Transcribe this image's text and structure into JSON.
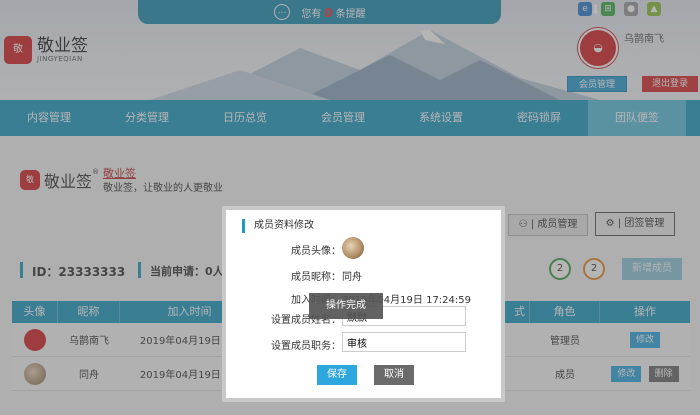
{
  "notice": {
    "prefix": "您有",
    "count": "0",
    "suffix": "条提醒"
  },
  "brand": {
    "name": "敬业签",
    "pinyin": "JINGYEQIAN",
    "logo_text": "敬",
    "reg_mark": "®"
  },
  "platform_icons": [
    "ie-icon",
    "windows-icon",
    "apple-icon",
    "android-icon"
  ],
  "user": {
    "name": "乌鹊南飞",
    "member_center": "会员管理",
    "logout": "退出登录"
  },
  "nav": {
    "items": [
      "内容管理",
      "分类管理",
      "日历总览",
      "会员管理",
      "系统设置",
      "密码锁屏",
      "团队便签"
    ],
    "active_index": 6
  },
  "page": {
    "slogan_link": "敬业签",
    "slogan_text": "敬业签，让敬业的人更敬业",
    "member_mgmt_btn": "| 成员管理",
    "team_note_btn": "| 团签管理",
    "team_id": "ID：23333333",
    "apply_label": "当前申请：0人",
    "count_green": "2",
    "count_orange": "2",
    "add_member_btn": "新增成员"
  },
  "table": {
    "columns": [
      "头像",
      "昵称",
      "加入时间",
      "式",
      "角色",
      "操作"
    ],
    "rows": [
      {
        "nick": "乌鹊南飞",
        "join_time": "2019年04月19日 14:",
        "role": "管理员",
        "actions": [
          "修改"
        ]
      },
      {
        "nick": "同舟",
        "join_time": "2019年04月19日 17:",
        "role": "成员",
        "actions": [
          "修改",
          "删除"
        ]
      }
    ]
  },
  "modal": {
    "title": "成员资料修改",
    "avatar_label": "成员头像：",
    "nick_label": "成员昵称：",
    "nick_value": "同舟",
    "join_label": "加入时间：",
    "join_value": "2019年04月19日 17:24:59",
    "name_label": "设置成员姓名：",
    "name_value": "默默",
    "role_label": "设置成员职务：",
    "role_value": "审核",
    "save": "保存",
    "cancel": "取消",
    "toast": "操作完成"
  },
  "colors": {
    "primary": "#1f9bc2",
    "danger": "#d82a31",
    "brand_red": "#d4262b",
    "save_blue": "#2ea7de"
  }
}
